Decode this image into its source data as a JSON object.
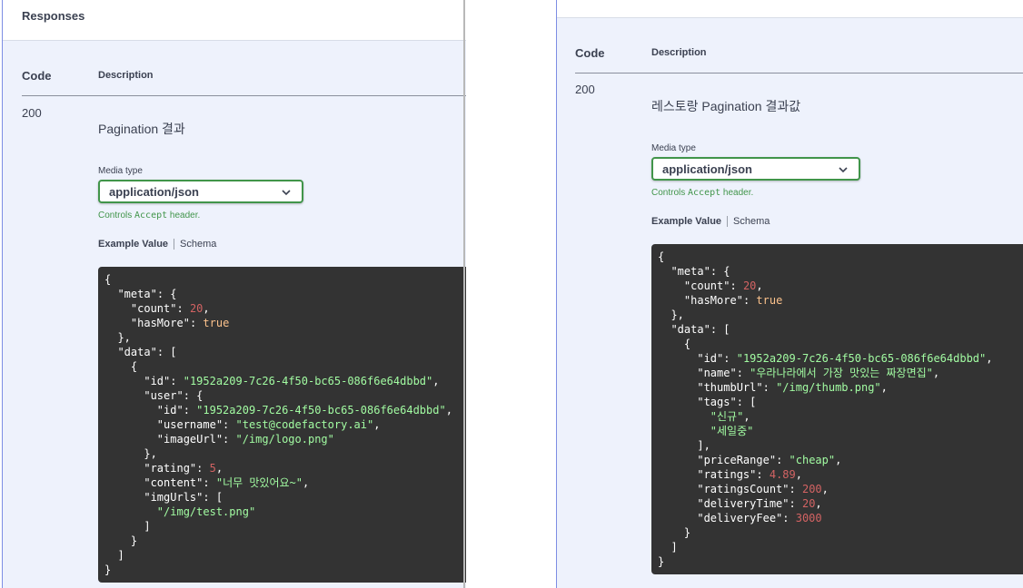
{
  "left": {
    "section_title": "Responses",
    "col_code": "Code",
    "col_description": "Description",
    "status_code": "200",
    "description": "Pagination 결과",
    "media_type_label": "Media type",
    "media_type_value": "application/json",
    "controls_prefix": "Controls ",
    "controls_code": "Accept",
    "controls_suffix": " header.",
    "tab_example": "Example Value",
    "tab_schema": "Schema",
    "code_lines": [
      [
        [
          "p",
          "{"
        ]
      ],
      [
        [
          "p",
          "  "
        ],
        [
          "k",
          "\"meta\""
        ],
        [
          "p",
          ": {"
        ]
      ],
      [
        [
          "p",
          "    "
        ],
        [
          "k",
          "\"count\""
        ],
        [
          "p",
          ": "
        ],
        [
          "n",
          "20"
        ],
        [
          "p",
          ","
        ]
      ],
      [
        [
          "p",
          "    "
        ],
        [
          "k",
          "\"hasMore\""
        ],
        [
          "p",
          ": "
        ],
        [
          "b",
          "true"
        ]
      ],
      [
        [
          "p",
          "  },"
        ]
      ],
      [
        [
          "p",
          "  "
        ],
        [
          "k",
          "\"data\""
        ],
        [
          "p",
          ": ["
        ]
      ],
      [
        [
          "p",
          "    {"
        ]
      ],
      [
        [
          "p",
          "      "
        ],
        [
          "k",
          "\"id\""
        ],
        [
          "p",
          ": "
        ],
        [
          "s",
          "\"1952a209-7c26-4f50-bc65-086f6e64dbbd\""
        ],
        [
          "p",
          ","
        ]
      ],
      [
        [
          "p",
          "      "
        ],
        [
          "k",
          "\"user\""
        ],
        [
          "p",
          ": {"
        ]
      ],
      [
        [
          "p",
          "        "
        ],
        [
          "k",
          "\"id\""
        ],
        [
          "p",
          ": "
        ],
        [
          "s",
          "\"1952a209-7c26-4f50-bc65-086f6e64dbbd\""
        ],
        [
          "p",
          ","
        ]
      ],
      [
        [
          "p",
          "        "
        ],
        [
          "k",
          "\"username\""
        ],
        [
          "p",
          ": "
        ],
        [
          "s",
          "\"test@codefactory.ai\""
        ],
        [
          "p",
          ","
        ]
      ],
      [
        [
          "p",
          "        "
        ],
        [
          "k",
          "\"imageUrl\""
        ],
        [
          "p",
          ": "
        ],
        [
          "s",
          "\"/img/logo.png\""
        ]
      ],
      [
        [
          "p",
          "      },"
        ]
      ],
      [
        [
          "p",
          "      "
        ],
        [
          "k",
          "\"rating\""
        ],
        [
          "p",
          ": "
        ],
        [
          "n",
          "5"
        ],
        [
          "p",
          ","
        ]
      ],
      [
        [
          "p",
          "      "
        ],
        [
          "k",
          "\"content\""
        ],
        [
          "p",
          ": "
        ],
        [
          "s",
          "\"너무 맛있어요~\""
        ],
        [
          "p",
          ","
        ]
      ],
      [
        [
          "p",
          "      "
        ],
        [
          "k",
          "\"imgUrls\""
        ],
        [
          "p",
          ": ["
        ]
      ],
      [
        [
          "p",
          "        "
        ],
        [
          "s",
          "\"/img/test.png\""
        ]
      ],
      [
        [
          "p",
          "      ]"
        ]
      ],
      [
        [
          "p",
          "    }"
        ]
      ],
      [
        [
          "p",
          "  ]"
        ]
      ],
      [
        [
          "p",
          "}"
        ]
      ]
    ]
  },
  "right": {
    "col_code": "Code",
    "col_description": "Description",
    "status_code": "200",
    "description": "레스토랑 Pagination 결과값",
    "media_type_label": "Media type",
    "media_type_value": "application/json",
    "controls_prefix": "Controls ",
    "controls_code": "Accept",
    "controls_suffix": " header.",
    "tab_example": "Example Value",
    "tab_schema": "Schema",
    "code_lines": [
      [
        [
          "p",
          "{"
        ]
      ],
      [
        [
          "p",
          "  "
        ],
        [
          "k",
          "\"meta\""
        ],
        [
          "p",
          ": {"
        ]
      ],
      [
        [
          "p",
          "    "
        ],
        [
          "k",
          "\"count\""
        ],
        [
          "p",
          ": "
        ],
        [
          "n",
          "20"
        ],
        [
          "p",
          ","
        ]
      ],
      [
        [
          "p",
          "    "
        ],
        [
          "k",
          "\"hasMore\""
        ],
        [
          "p",
          ": "
        ],
        [
          "b",
          "true"
        ]
      ],
      [
        [
          "p",
          "  },"
        ]
      ],
      [
        [
          "p",
          "  "
        ],
        [
          "k",
          "\"data\""
        ],
        [
          "p",
          ": ["
        ]
      ],
      [
        [
          "p",
          "    {"
        ]
      ],
      [
        [
          "p",
          "      "
        ],
        [
          "k",
          "\"id\""
        ],
        [
          "p",
          ": "
        ],
        [
          "s",
          "\"1952a209-7c26-4f50-bc65-086f6e64dbbd\""
        ],
        [
          "p",
          ","
        ]
      ],
      [
        [
          "p",
          "      "
        ],
        [
          "k",
          "\"name\""
        ],
        [
          "p",
          ": "
        ],
        [
          "s",
          "\"우라나라에서 가장 맛있는 짜장면집\""
        ],
        [
          "p",
          ","
        ]
      ],
      [
        [
          "p",
          "      "
        ],
        [
          "k",
          "\"thumbUrl\""
        ],
        [
          "p",
          ": "
        ],
        [
          "s",
          "\"/img/thumb.png\""
        ],
        [
          "p",
          ","
        ]
      ],
      [
        [
          "p",
          "      "
        ],
        [
          "k",
          "\"tags\""
        ],
        [
          "p",
          ": ["
        ]
      ],
      [
        [
          "p",
          "        "
        ],
        [
          "s",
          "\"신규\""
        ],
        [
          "p",
          ","
        ]
      ],
      [
        [
          "p",
          "        "
        ],
        [
          "s",
          "\"세일중\""
        ]
      ],
      [
        [
          "p",
          "      ],"
        ]
      ],
      [
        [
          "p",
          "      "
        ],
        [
          "k",
          "\"priceRange\""
        ],
        [
          "p",
          ": "
        ],
        [
          "s",
          "\"cheap\""
        ],
        [
          "p",
          ","
        ]
      ],
      [
        [
          "p",
          "      "
        ],
        [
          "k",
          "\"ratings\""
        ],
        [
          "p",
          ": "
        ],
        [
          "n",
          "4.89"
        ],
        [
          "p",
          ","
        ]
      ],
      [
        [
          "p",
          "      "
        ],
        [
          "k",
          "\"ratingsCount\""
        ],
        [
          "p",
          ": "
        ],
        [
          "n",
          "200"
        ],
        [
          "p",
          ","
        ]
      ],
      [
        [
          "p",
          "      "
        ],
        [
          "k",
          "\"deliveryTime\""
        ],
        [
          "p",
          ": "
        ],
        [
          "n",
          "20"
        ],
        [
          "p",
          ","
        ]
      ],
      [
        [
          "p",
          "      "
        ],
        [
          "k",
          "\"deliveryFee\""
        ],
        [
          "p",
          ": "
        ],
        [
          "n",
          "3000"
        ]
      ],
      [
        [
          "p",
          "    }"
        ]
      ],
      [
        [
          "p",
          "  ]"
        ]
      ],
      [
        [
          "p",
          "}"
        ]
      ]
    ]
  },
  "icons": {
    "select_chevron": "chevron-down-icon"
  },
  "colors": {
    "panel_bg": "#eef2fc",
    "select_border": "#41954a",
    "code_bg": "#333333",
    "code_string": "#a2fca2",
    "code_number": "#d36363",
    "code_bool": "#fcc28c"
  }
}
